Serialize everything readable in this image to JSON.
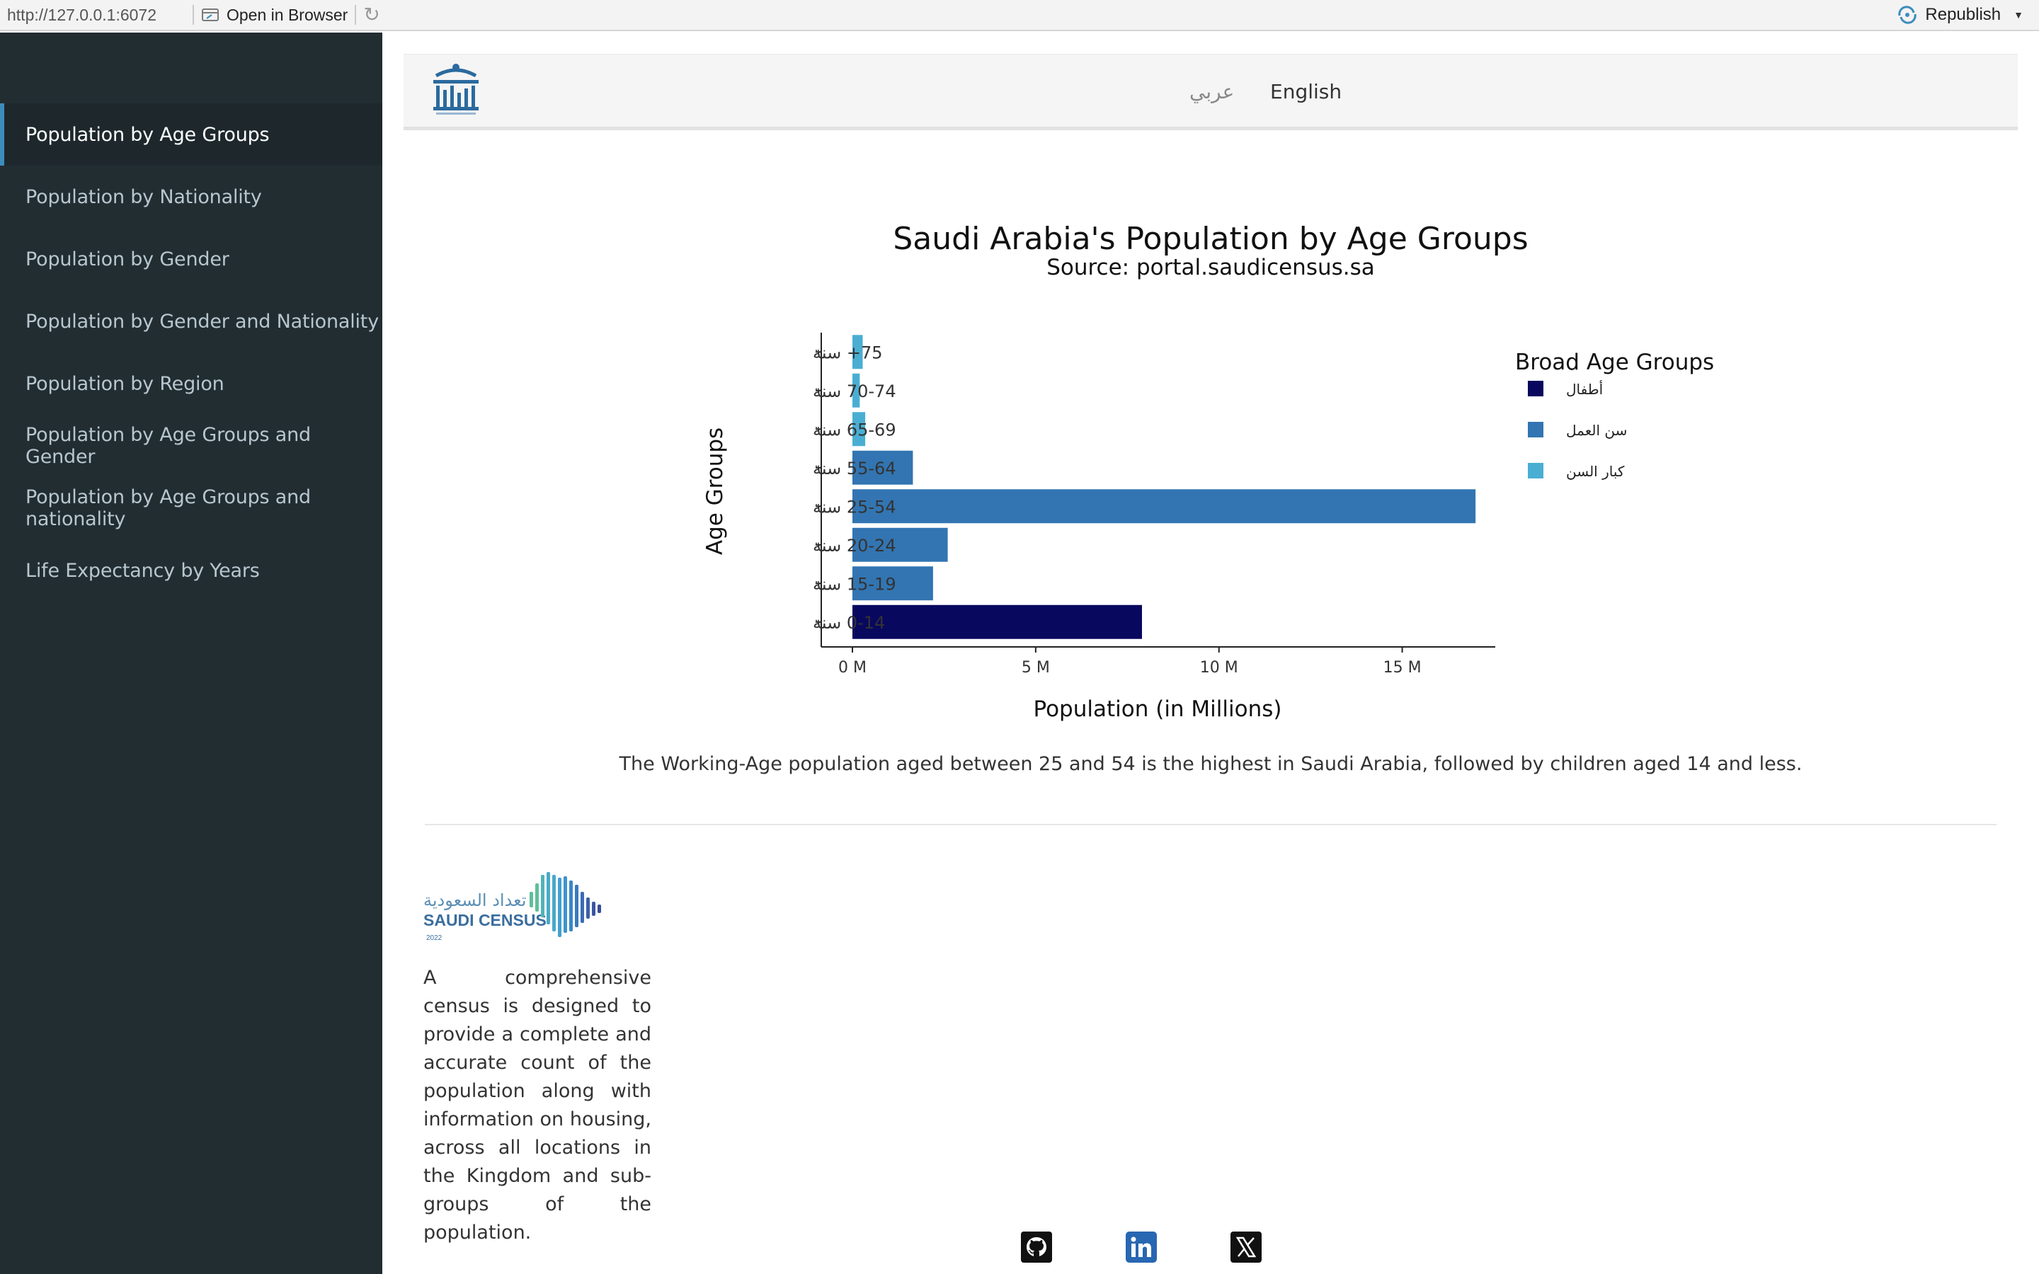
{
  "topbar": {
    "url": "http://127.0.0.1:6072",
    "open_in_browser": "Open in Browser",
    "republish": "Republish"
  },
  "sidebar": {
    "items": [
      {
        "label": "Population by Age Groups",
        "active": true
      },
      {
        "label": "Population by Nationality",
        "active": false
      },
      {
        "label": "Population by Gender",
        "active": false
      },
      {
        "label": "Population by Gender and Nationality",
        "active": false
      },
      {
        "label": "Population by Region",
        "active": false
      },
      {
        "label": "Population by Age Groups and Gender",
        "active": false
      },
      {
        "label": "Population by Age Groups and nationality",
        "active": false
      },
      {
        "label": "Life Expectancy by Years",
        "active": false
      }
    ]
  },
  "header": {
    "lang_arabic": "عربي",
    "lang_english": "English"
  },
  "chart_data": {
    "type": "bar",
    "orientation": "horizontal",
    "title": "Saudi Arabia's Population by Age Groups",
    "subtitle": "Source: portal.saudicensus.sa",
    "xlabel": "Population (in Millions)",
    "ylabel": "Age Groups",
    "categories": [
      "0-14 سنة",
      "15-19 سنة",
      "20-24 سنة",
      "25-54 سنة",
      "55-64 سنة",
      "65-69 سنة",
      "70-74 سنة",
      "75+ سنة"
    ],
    "values": [
      7.9,
      2.2,
      2.6,
      17.0,
      1.65,
      0.35,
      0.2,
      0.28
    ],
    "groups": [
      "أطفال",
      "سن العمل",
      "سن العمل",
      "سن العمل",
      "سن العمل",
      "كبار السن",
      "كبار السن",
      "كبار السن"
    ],
    "xlim": [
      0,
      17.5
    ],
    "xticks": [
      0,
      5,
      10,
      15
    ],
    "xtick_labels": [
      "0 M",
      "5 M",
      "10 M",
      "15 M"
    ],
    "legend": {
      "title": "Broad Age Groups",
      "position": "right",
      "entries": [
        {
          "label": "أطفال",
          "color": "#08085e"
        },
        {
          "label": "سن العمل",
          "color": "#3275b2"
        },
        {
          "label": "كبار السن",
          "color": "#4aaed3"
        }
      ]
    },
    "grid": false
  },
  "caption": "The Working-Age population aged between 25 and 54 is the highest in Saudi Arabia, followed by children aged 14 and less.",
  "footer": {
    "census_logo_ar": "تعداد السعودية",
    "census_logo_en": "SAUDI CENSUS",
    "census_logo_year": "2022",
    "description": "A comprehensive census is designed to provide a complete and accurate count of the population along with information on housing, across all locations in the Kingdom and sub-groups of the population."
  },
  "icons": [
    "browser-icon",
    "refresh-icon",
    "republish-icon",
    "github-icon",
    "linkedin-icon",
    "x-icon"
  ],
  "colors": {
    "sidebar_bg": "#222d32",
    "sidebar_active": "#1e282c",
    "accent": "#3c8dbc"
  }
}
